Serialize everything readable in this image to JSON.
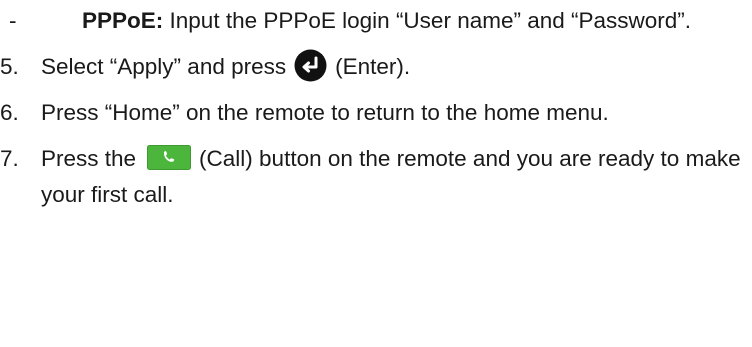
{
  "doc": {
    "pppoe": {
      "marker": "-",
      "label": "PPPoE:",
      "text": " Input the PPPoE login “User name” and “Password”."
    },
    "step5": {
      "marker": "5.",
      "before": "Select “Apply” and press",
      "icon": "enter-key-icon",
      "after": "(Enter)."
    },
    "step6": {
      "marker": "6.",
      "text": "Press “Home” on the remote to return to the home menu."
    },
    "step7": {
      "marker": "7.",
      "before": "Press the",
      "icon": "call-button-icon",
      "after": "(Call) button on the remote and you are ready to make your first call."
    }
  },
  "colors": {
    "text": "#1a1a1a",
    "enter_icon": "#111111",
    "call_icon_fill": "#4cb63c",
    "call_icon_glyph": "#ffffff"
  }
}
